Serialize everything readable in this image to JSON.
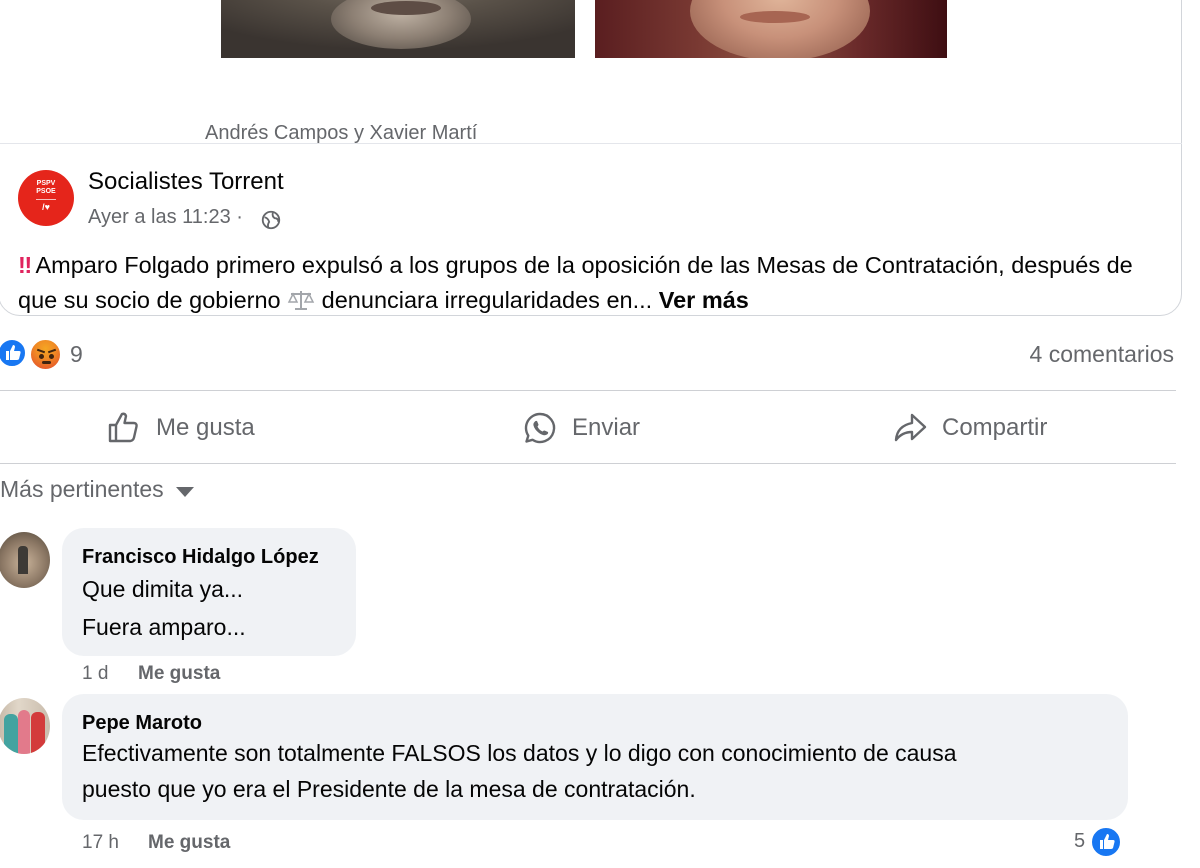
{
  "post": {
    "image_caption": "Andrés Campos y Xavier Martí",
    "page": {
      "name": "Socialistes Torrent",
      "avatar_text_1": "PSPV",
      "avatar_text_2": "PSOE",
      "avatar_text_3": "/♥",
      "time": "Ayer a las 11:23 ·"
    },
    "text_part1": "Amparo Folgado primero expulsó a los grupos de la oposición de las Mesas de Contratación, después de que su socio de gobierno",
    "text_part2": "denunciara irregularidades en...",
    "emoji_excl": "‼",
    "see_more": "Ver más",
    "reaction_count": "9",
    "comment_count": "4 comentarios"
  },
  "actions": {
    "like": "Me gusta",
    "send": "Enviar",
    "share": "Compartir"
  },
  "sort": {
    "label": "Más pertinentes"
  },
  "comments": [
    {
      "author": "Francisco Hidalgo López",
      "lines": [
        "Que dimita ya...",
        "Fuera amparo..."
      ],
      "time": "1 d",
      "like": "Me gusta"
    },
    {
      "author": "Pepe Maroto",
      "lines": [
        "Efectivamente son totalmente FALSOS los datos y lo digo con conocimiento de causa",
        "puesto que yo era el Presidente de la mesa de contratación."
      ],
      "time": "17 h",
      "like": "Me gusta",
      "reactions": "5"
    }
  ],
  "colors": {
    "accent": "#1877f2",
    "secondary_text": "#65676b",
    "bubble": "#f0f2f5",
    "page_avatar": "#e5251b"
  }
}
